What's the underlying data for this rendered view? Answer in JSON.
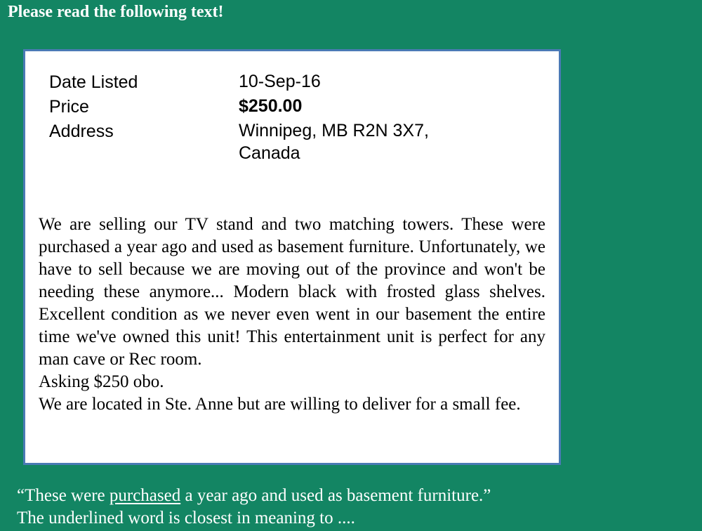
{
  "heading": "Please read the following text!",
  "listing": {
    "rows": [
      {
        "label": "Date Listed",
        "value": "10-Sep-16"
      },
      {
        "label": "Price",
        "value": "$250.00"
      },
      {
        "label": "Address",
        "value": "Winnipeg, MB R2N 3X7, Canada"
      }
    ]
  },
  "description": {
    "paragraph1": "We are selling our TV stand and two matching towers. These were purchased a year ago and used as basement furniture. Unfortunately, we have to sell because we are moving out of the province and won't be needing these anymore... Modern black with frosted glass shelves. Excellent condition as we never even went in our basement the entire time we've owned this unit! This entertainment unit is perfect for any man cave or Rec room.",
    "paragraph2": "Asking $250 obo.",
    "paragraph3": "We are located in Ste. Anne but are willing to deliver for a small fee."
  },
  "question": {
    "quote_before": "“These were ",
    "quote_underlined": "purchased",
    "quote_after": " a year ago and used as basement furniture.”",
    "prompt": "The underlined word is closest in meaning to ...."
  },
  "colors": {
    "background": "#138563",
    "card_border": "#4a7ab5",
    "card_background": "#ffffff"
  }
}
